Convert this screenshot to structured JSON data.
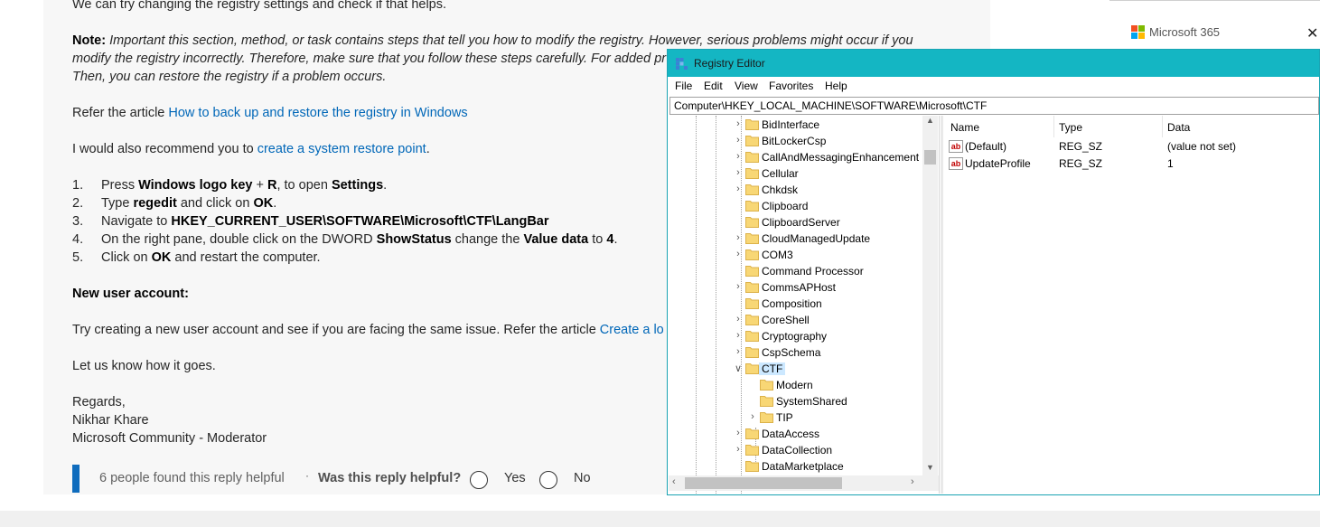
{
  "post": {
    "line0": "We can try changing the registry settings and check if that helps.",
    "note_label": "Note:",
    "note_line1": "Important this section, method, or task contains steps that tell you how to modify the registry. However, serious problems might occur if you",
    "note_line2": "modify the registry incorrectly. Therefore, make sure that you follow these steps carefully. For added pr",
    "note_line3": "Then, you can restore the registry if a problem occurs.",
    "refer_prefix": "Refer the article ",
    "refer_link": "How to back up and restore the registry in Windows",
    "recommend_prefix": "I would also recommend you to ",
    "recommend_link": "create a system restore point",
    "recommend_suffix": ".",
    "steps": [
      {
        "num": "1.",
        "a": "Press ",
        "b": "Windows logo key",
        "c": " + ",
        "d": "R",
        "e": ", to open ",
        "f": "Settings",
        "g": "."
      },
      {
        "num": "2.",
        "a": "Type ",
        "b": "regedit",
        "c": " and click on ",
        "d": "OK",
        "e": "."
      },
      {
        "num": "3.",
        "a": "Navigate to ",
        "b": "HKEY_CURRENT_USER\\SOFTWARE\\Microsoft\\CTF\\LangBar"
      },
      {
        "num": "4.",
        "a": "On the right pane, double click on the DWORD ",
        "b": "ShowStatus",
        "c": " change the ",
        "d": "Value data",
        "e": " to ",
        "f": "4",
        "g": "."
      },
      {
        "num": "5.",
        "a": "Click on ",
        "b": "OK",
        "c": " and restart the computer."
      }
    ],
    "new_user_heading": "New user account:",
    "try_text": "Try creating a new user account and see if you are facing the same issue. Refer the article ",
    "try_link": "Create a lo",
    "let_us_know": "Let us know how it goes.",
    "regards": "Regards,",
    "name": "Nikhar Khare",
    "role": "Microsoft Community - Moderator"
  },
  "helpful": {
    "count_text": "6 people found this reply helpful",
    "separator": "·",
    "question": "Was this reply helpful?",
    "yes": "Yes",
    "no": "No"
  },
  "ms365": {
    "label": "Microsoft 365",
    "close": "✕",
    "logo_colors": [
      "#f25022",
      "#7fba00",
      "#00a4ef",
      "#ffb900"
    ]
  },
  "regedit": {
    "title": "Registry Editor",
    "menu": [
      "File",
      "Edit",
      "View",
      "Favorites",
      "Help"
    ],
    "address": "Computer\\HKEY_LOCAL_MACHINE\\SOFTWARE\\Microsoft\\CTF",
    "tree": [
      {
        "label": "BidInterface",
        "level": 0,
        "expander": true
      },
      {
        "label": "BitLockerCsp",
        "level": 0,
        "expander": true
      },
      {
        "label": "CallAndMessagingEnhancement",
        "level": 0,
        "expander": true
      },
      {
        "label": "Cellular",
        "level": 0,
        "expander": true
      },
      {
        "label": "Chkdsk",
        "level": 0,
        "expander": true
      },
      {
        "label": "Clipboard",
        "level": 0,
        "expander": false
      },
      {
        "label": "ClipboardServer",
        "level": 0,
        "expander": false
      },
      {
        "label": "CloudManagedUpdate",
        "level": 0,
        "expander": true
      },
      {
        "label": "COM3",
        "level": 0,
        "expander": true
      },
      {
        "label": "Command Processor",
        "level": 0,
        "expander": false
      },
      {
        "label": "CommsAPHost",
        "level": 0,
        "expander": true
      },
      {
        "label": "Composition",
        "level": 0,
        "expander": false
      },
      {
        "label": "CoreShell",
        "level": 0,
        "expander": true
      },
      {
        "label": "Cryptography",
        "level": 0,
        "expander": true
      },
      {
        "label": "CspSchema",
        "level": 0,
        "expander": true
      },
      {
        "label": "CTF",
        "level": 0,
        "expander": true,
        "expanded": true,
        "selected": true
      },
      {
        "label": "Modern",
        "level": 1,
        "expander": false
      },
      {
        "label": "SystemShared",
        "level": 1,
        "expander": false
      },
      {
        "label": "TIP",
        "level": 1,
        "expander": true
      },
      {
        "label": "DataAccess",
        "level": 0,
        "expander": true
      },
      {
        "label": "DataCollection",
        "level": 0,
        "expander": true
      },
      {
        "label": "DataMarketplace",
        "level": 0,
        "expander": false
      }
    ],
    "columns": {
      "name": "Name",
      "type": "Type",
      "data": "Data"
    },
    "values": [
      {
        "name": "(Default)",
        "type": "REG_SZ",
        "data": "(value not set)"
      },
      {
        "name": "UpdateProfile",
        "type": "REG_SZ",
        "data": "1"
      }
    ],
    "icons": {
      "title": "regedit-icon",
      "value": "string-value-icon",
      "folder": "folder-icon"
    }
  }
}
